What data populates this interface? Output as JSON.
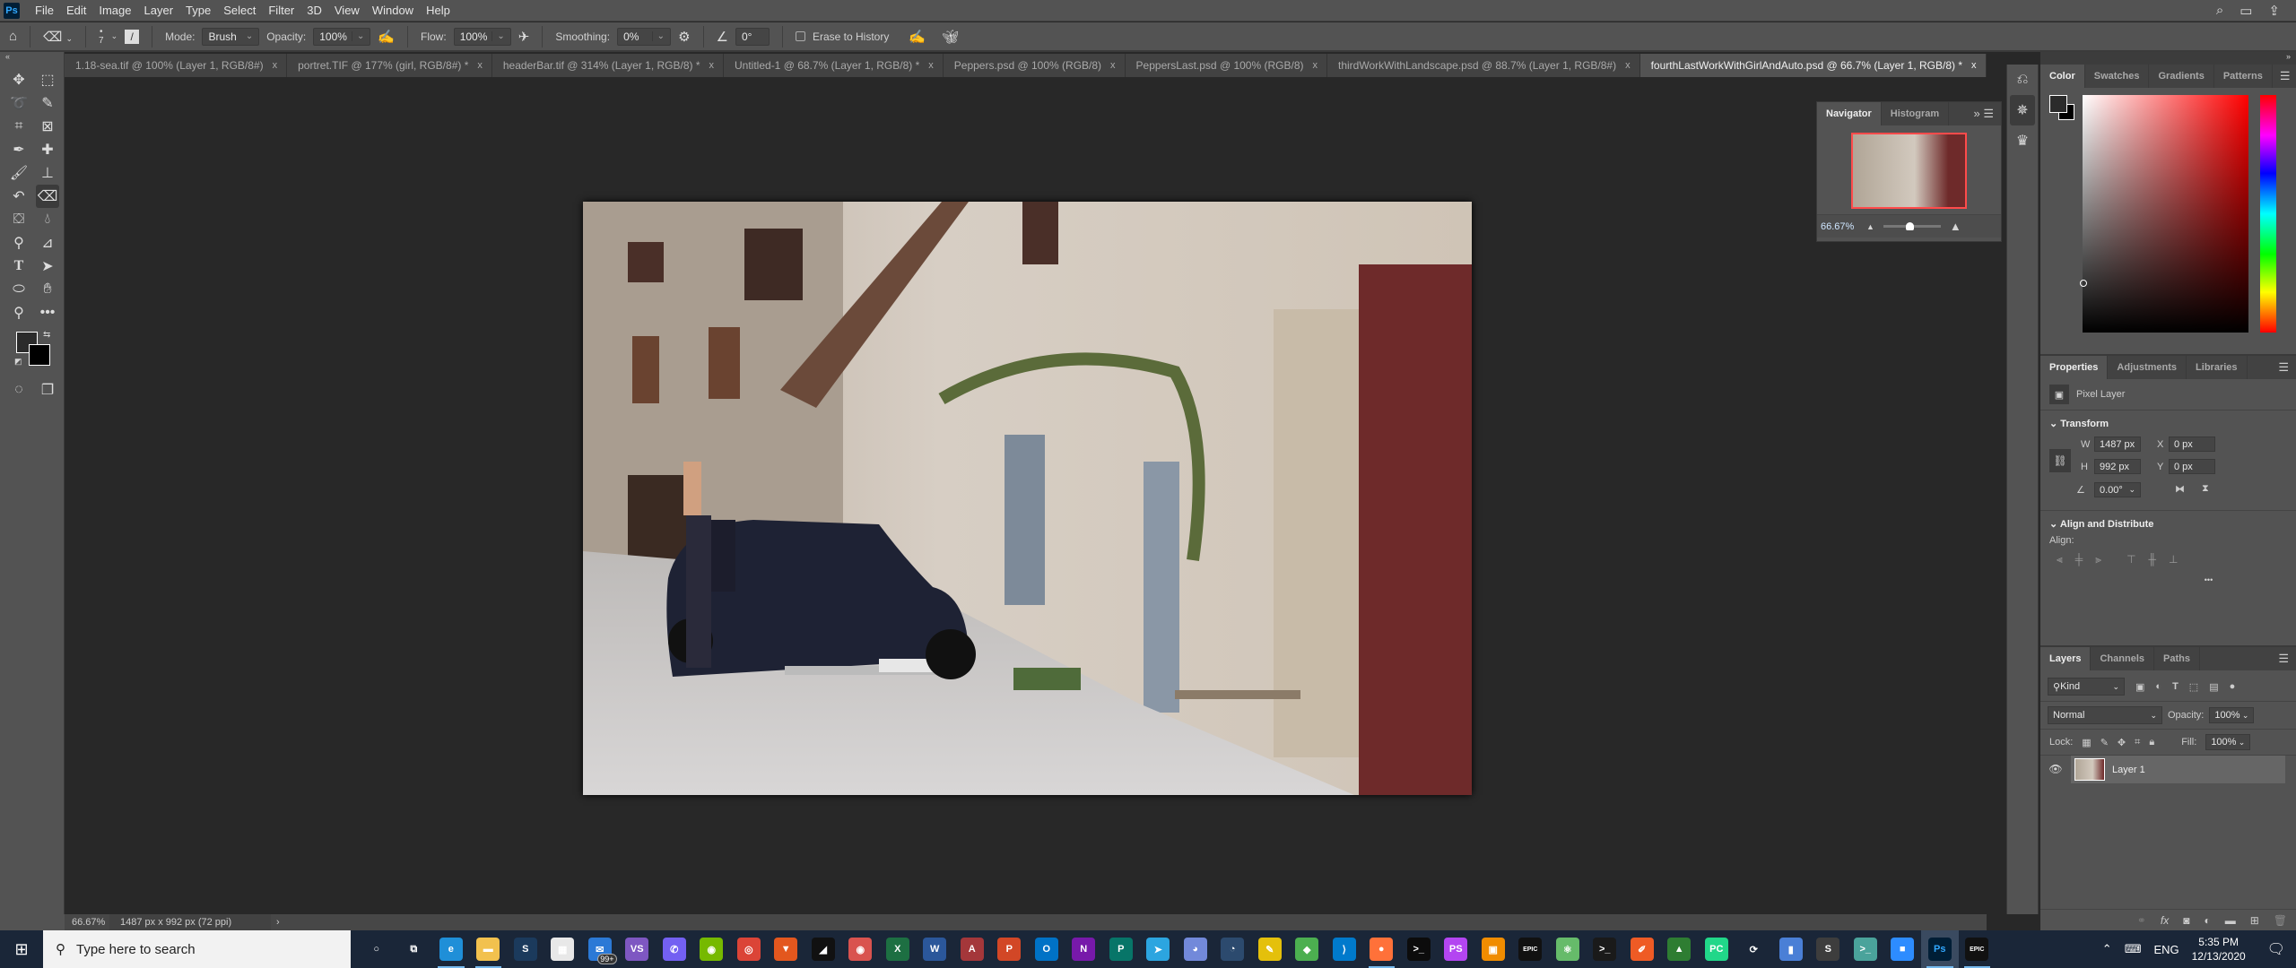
{
  "app": {
    "name": "Ps"
  },
  "menu": [
    "File",
    "Edit",
    "Image",
    "Layer",
    "Type",
    "Select",
    "Filter",
    "3D",
    "View",
    "Window",
    "Help"
  ],
  "options": {
    "brush_size": "7",
    "mode_label": "Mode:",
    "mode_value": "Brush",
    "opacity_label": "Opacity:",
    "opacity_value": "100%",
    "flow_label": "Flow:",
    "flow_value": "100%",
    "smoothing_label": "Smoothing:",
    "smoothing_value": "0%",
    "angle_value": "0°",
    "erase_history_label": "Erase to History",
    "erase_history_checked": false
  },
  "tabs": [
    {
      "label": "1.18-sea.tif @ 100% (Layer 1, RGB/8#)",
      "active": false
    },
    {
      "label": "portret.TIF @ 177% (girl, RGB/8#) *",
      "active": false
    },
    {
      "label": "headerBar.tif @ 314% (Layer 1, RGB/8) *",
      "active": false
    },
    {
      "label": "Untitled-1 @ 68.7% (Layer 1, RGB/8) *",
      "active": false
    },
    {
      "label": "Peppers.psd @ 100% (RGB/8)",
      "active": false
    },
    {
      "label": "PeppersLast.psd @ 100% (RGB/8)",
      "active": false
    },
    {
      "label": "thirdWorkWithLandscape.psd @ 88.7% (Layer 1, RGB/8#)",
      "active": false
    },
    {
      "label": "fourthLastWorkWithGirlAndAuto.psd @ 66.7% (Layer 1, RGB/8) *",
      "active": true
    }
  ],
  "tab_close": "x",
  "status": {
    "zoom": "66.67%",
    "doc_info": "1487 px x 992 px (72 ppi)"
  },
  "navigator": {
    "tabs": [
      "Navigator",
      "Histogram"
    ],
    "zoom": "66.67%",
    "zoom_slider_percent": 45,
    "view_box_color": "#ff4b4b"
  },
  "color": {
    "tabs": [
      "Color",
      "Swatches",
      "Gradients",
      "Patterns"
    ],
    "hue_color": "#ff0000",
    "foreground": "#2b2b2b",
    "background": "#000000"
  },
  "properties": {
    "tabs": [
      "Properties",
      "Adjustments",
      "Libraries"
    ],
    "kind": "Pixel Layer",
    "transform_title": "Transform",
    "w_label": "W",
    "w": "1487 px",
    "h_label": "H",
    "h": "992 px",
    "x_label": "X",
    "x": "0 px",
    "y_label": "Y",
    "y": "0 px",
    "angle": "0.00°",
    "align_title": "Align and Distribute",
    "align_label": "Align:",
    "more": "•••"
  },
  "layers": {
    "tabs": [
      "Layers",
      "Channels",
      "Paths"
    ],
    "filter": "Kind",
    "blend_mode": "Normal",
    "opacity_label": "Opacity:",
    "opacity": "100%",
    "lock_label": "Lock:",
    "fill_label": "Fill:",
    "fill": "100%",
    "items": [
      {
        "name": "Layer 1",
        "visible": true,
        "selected": true
      }
    ]
  },
  "taskbar": {
    "search_placeholder": "Type here to search",
    "mail_badge": "99+",
    "icons": [
      {
        "name": "cortana",
        "glyph": "○",
        "color": "transparent"
      },
      {
        "name": "task-view",
        "glyph": "⧉",
        "color": "transparent"
      },
      {
        "name": "edge",
        "glyph": "e",
        "color": "#1f8fd8"
      },
      {
        "name": "file-explorer",
        "glyph": "▬",
        "color": "#f2c14e"
      },
      {
        "name": "steam",
        "glyph": "S",
        "color": "#1b3a5c"
      },
      {
        "name": "microsoft-store",
        "glyph": "▦",
        "color": "#e8e8e8"
      },
      {
        "name": "mail",
        "glyph": "✉",
        "color": "#2b79d6"
      },
      {
        "name": "visual-studio",
        "glyph": "VS",
        "color": "#7e57c2"
      },
      {
        "name": "viber",
        "glyph": "✆",
        "color": "#7360f2"
      },
      {
        "name": "nvidia",
        "glyph": "◉",
        "color": "#76b900"
      },
      {
        "name": "chrome",
        "glyph": "◎",
        "color": "#db4437"
      },
      {
        "name": "shield-app",
        "glyph": "▼",
        "color": "#e3571e"
      },
      {
        "name": "dark-app",
        "glyph": "◢",
        "color": "#111111"
      },
      {
        "name": "media-app",
        "glyph": "◉",
        "color": "#d9534f"
      },
      {
        "name": "excel",
        "glyph": "X",
        "color": "#1d6f42"
      },
      {
        "name": "word",
        "glyph": "W",
        "color": "#2b579a"
      },
      {
        "name": "access",
        "glyph": "A",
        "color": "#a4373a"
      },
      {
        "name": "powerpoint",
        "glyph": "P",
        "color": "#d24726"
      },
      {
        "name": "outlook",
        "glyph": "O",
        "color": "#0072c6"
      },
      {
        "name": "onenote",
        "glyph": "N",
        "color": "#7719aa"
      },
      {
        "name": "publisher",
        "glyph": "P",
        "color": "#077568"
      },
      {
        "name": "telegram",
        "glyph": "➤",
        "color": "#2ca5e0"
      },
      {
        "name": "discord",
        "glyph": "◕",
        "color": "#7289da"
      },
      {
        "name": "headset-app",
        "glyph": "◔",
        "color": "#2c4a6e"
      },
      {
        "name": "tools-app",
        "glyph": "✎",
        "color": "#e4c00b"
      },
      {
        "name": "git-app",
        "glyph": "◆",
        "color": "#4caf50"
      },
      {
        "name": "vscode",
        "glyph": "⟩",
        "color": "#007acc"
      },
      {
        "name": "firefox",
        "glyph": "●",
        "color": "#ff7139"
      },
      {
        "name": "command-prompt",
        "glyph": ">_",
        "color": "#0c0c0c"
      },
      {
        "name": "phpstorm",
        "glyph": "PS",
        "color": "#b345f1"
      },
      {
        "name": "orange-app",
        "glyph": "▣",
        "color": "#f08c00"
      },
      {
        "name": "epic-games",
        "glyph": "EPIC",
        "color": "#111111"
      },
      {
        "name": "atom",
        "glyph": "⚛",
        "color": "#66bb6a"
      },
      {
        "name": "terminal",
        "glyph": ">_",
        "color": "#1a1a1a"
      },
      {
        "name": "postman",
        "glyph": "✐",
        "color": "#ef5b25"
      },
      {
        "name": "rocket-app",
        "glyph": "▲",
        "color": "#2e7d32"
      },
      {
        "name": "pycharm",
        "glyph": "PC",
        "color": "#21d789"
      },
      {
        "name": "orange-arcs-app",
        "glyph": "⟳",
        "color": "transparent"
      },
      {
        "name": "chart-app",
        "glyph": "▮",
        "color": "#4a7fd6"
      },
      {
        "name": "sublime-text",
        "glyph": "S",
        "color": "#3d3d3d"
      },
      {
        "name": "teal-terminal",
        "glyph": ">_",
        "color": "#4aa39b"
      },
      {
        "name": "zoom",
        "glyph": "■",
        "color": "#2d8cff"
      },
      {
        "name": "photoshop",
        "glyph": "Ps",
        "color": "#001e36"
      },
      {
        "name": "epic-games-launcher",
        "glyph": "EPIC",
        "color": "#111111"
      }
    ],
    "running": [
      "edge",
      "file-explorer",
      "photoshop",
      "epic-games-launcher",
      "firefox"
    ],
    "active": "photoshop",
    "language": "ENG",
    "time": "5:35 PM",
    "date": "12/13/2020"
  }
}
